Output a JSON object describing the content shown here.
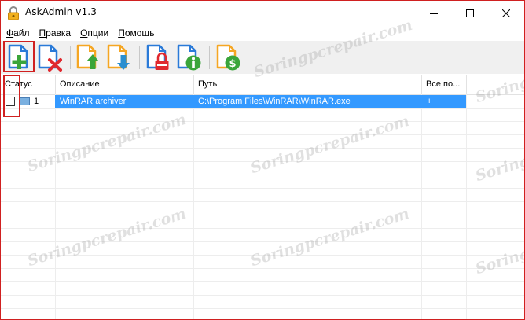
{
  "window": {
    "title": "AskAdmin v1.3",
    "controls": {
      "minimize": "minimize",
      "maximize": "maximize",
      "close": "close"
    }
  },
  "menu": {
    "items": [
      {
        "label": "Файл",
        "underline": "Ф",
        "rest": "айл"
      },
      {
        "label": "Правка",
        "underline": "П",
        "rest": "равка"
      },
      {
        "label": "Опции",
        "underline": "О",
        "rest": "пции"
      },
      {
        "label": "Помощь",
        "underline": "П",
        "rest": "омощь"
      }
    ]
  },
  "toolbar": {
    "buttons": [
      {
        "name": "add-file-button",
        "icon": "file-plus-icon",
        "highlighted": true
      },
      {
        "name": "remove-file-button",
        "icon": "file-delete-icon"
      },
      {
        "name": "move-up-button",
        "icon": "file-arrow-up-icon"
      },
      {
        "name": "move-down-button",
        "icon": "file-arrow-down-icon"
      },
      {
        "name": "lock-button",
        "icon": "file-lock-icon"
      },
      {
        "name": "info-button",
        "icon": "file-info-icon"
      },
      {
        "name": "donate-button",
        "icon": "file-dollar-icon"
      }
    ]
  },
  "table": {
    "columns": [
      "Статус",
      "Описание",
      "Путь",
      "Все по..."
    ],
    "rows": [
      {
        "status_checked": false,
        "index": "1",
        "description": "WinRAR archiver",
        "path": "C:\\Program Files\\WinRAR\\WinRAR.exe",
        "all_users": "+",
        "selected": true
      }
    ]
  },
  "watermark": "Soringpcrepair.com",
  "colors": {
    "highlight": "#d02020",
    "selection": "#3399ff",
    "accent_blue": "#2a7ad8",
    "accent_orange": "#f5a623",
    "accent_green": "#3aa53a",
    "accent_red": "#e0282e"
  }
}
